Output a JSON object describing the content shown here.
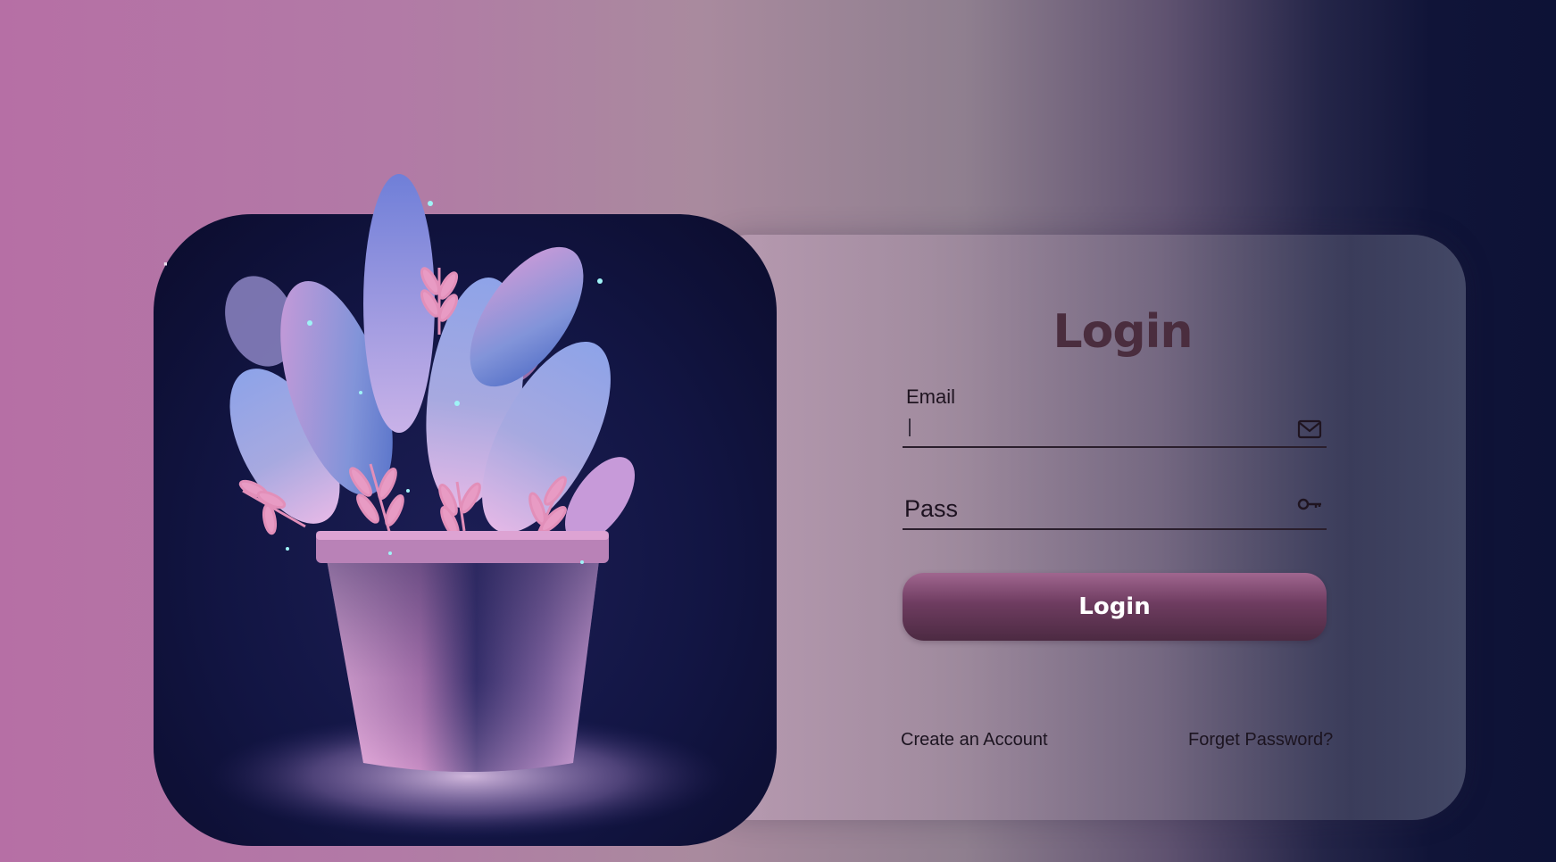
{
  "login_form": {
    "title": "Login",
    "email_label": "Email",
    "email_value": "",
    "email_icon": "mail-icon",
    "password_placeholder": "Pass",
    "password_icon": "key-icon",
    "submit_label": "Login",
    "create_account_label": "Create an Account",
    "forgot_password_label": "Forget Password?"
  },
  "illustration": {
    "subject": "potted-plant-icon"
  },
  "colors": {
    "button_top": "#a0668f",
    "button_bottom": "#4c2a42",
    "title": "#4a2d3e",
    "panel_bg": "#121543"
  }
}
